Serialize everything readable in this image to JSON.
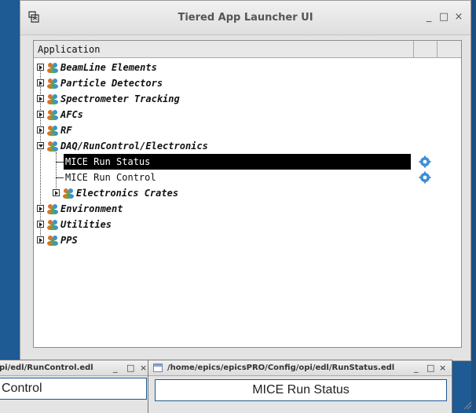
{
  "main_window": {
    "title": "Tiered App Launcher UI",
    "minimize": "_",
    "maximize": "□",
    "close": "×"
  },
  "tree": {
    "column_header": "Application",
    "items": [
      {
        "label": "BeamLine Elements",
        "type": "category",
        "expanded": false
      },
      {
        "label": "Particle Detectors",
        "type": "category",
        "expanded": false
      },
      {
        "label": "Spectrometer Tracking",
        "type": "category",
        "expanded": false
      },
      {
        "label": "AFCs",
        "type": "category",
        "expanded": false
      },
      {
        "label": "RF",
        "type": "category",
        "expanded": false
      },
      {
        "label": "DAQ/RunControl/Electronics",
        "type": "category",
        "expanded": true
      },
      {
        "label": "MICE Run Status",
        "type": "app",
        "selected": true
      },
      {
        "label": "MICE Run Control",
        "type": "app",
        "selected": false
      },
      {
        "label": "Electronics Crates",
        "type": "category",
        "expanded": false
      },
      {
        "label": "Environment",
        "type": "category",
        "expanded": false
      },
      {
        "label": "Utilities",
        "type": "category",
        "expanded": false
      },
      {
        "label": "PPS",
        "type": "category",
        "expanded": false
      }
    ]
  },
  "window_run_control": {
    "title": "pi/edl/RunControl.edl",
    "minimize": "_",
    "maximize": "□",
    "close": "×",
    "panel_label": "Control"
  },
  "window_run_status": {
    "title": "/home/epics/epicsPRO/Config/opi/edl/RunStatus.edl",
    "minimize": "_",
    "maximize": "□",
    "close": "×",
    "panel_label": "MICE Run Status"
  },
  "colors": {
    "desktop": "#1e5a93",
    "selection": "#000000",
    "gear": "#3c8fd6"
  },
  "icons": {
    "app": "tiered-launcher-icon",
    "category": "people-group-icon",
    "launch": "gear-icon"
  }
}
